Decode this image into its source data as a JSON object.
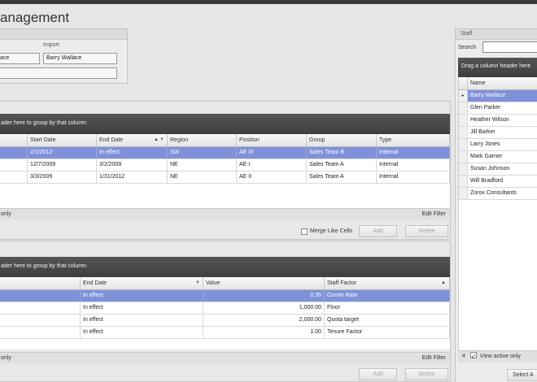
{
  "app": {
    "title": "anagement"
  },
  "import_panel": {
    "label": "Import",
    "left_value": "ace",
    "import_value": "Barry Wallace",
    "second_value": ""
  },
  "assignments": {
    "group_hint": "ader here to group by that column",
    "columns": [
      "Start Date",
      "End Date",
      "Region",
      "Position",
      "Group",
      "Type"
    ],
    "rows": [
      {
        "start": "2/1/2012",
        "end": "In effect",
        "region": "SW",
        "position": "AE III",
        "group": "Sales Team B",
        "type": "Internal",
        "selected": true
      },
      {
        "start": "12/7/2009",
        "end": "3/2/2009",
        "region": "NE",
        "position": "AE I",
        "group": "Sales Team A",
        "type": "Internal",
        "selected": false
      },
      {
        "start": "3/3/2009",
        "end": "1/31/2012",
        "region": "NE",
        "position": "AE II",
        "group": "Sales Team A",
        "type": "Internal",
        "selected": false
      }
    ],
    "footer_left": "only",
    "edit_filter": "Edit Filter",
    "merge_label": "Merge Like Cells",
    "add_label": "Add",
    "delete_label": "Delete"
  },
  "factors": {
    "group_hint": "ader here to group by that column",
    "columns": [
      "End Date",
      "Value",
      "Staff Factor"
    ],
    "rows": [
      {
        "end": "In effect",
        "value": "0.35",
        "factor": "Comm Rate",
        "selected": true
      },
      {
        "end": "In effect",
        "value": "1,000.00",
        "factor": "Floor",
        "selected": false
      },
      {
        "end": "In effect",
        "value": "2,000.00",
        "factor": "Quota target",
        "selected": false
      },
      {
        "end": "In effect",
        "value": "1.00",
        "factor": "Tenure Factor",
        "selected": false
      }
    ],
    "footer_left": "only",
    "edit_filter": "Edit Filter",
    "add_label": "Add",
    "delete_label": "Delete"
  },
  "staff": {
    "title": "Staff",
    "search_label": "Search",
    "search_value": "",
    "drag_hint": "Drag a column header here",
    "column": "Name",
    "names": [
      "Barry Wallace",
      "Glen Parker",
      "Heather Wilson",
      "Jill Barker",
      "Larry Jones",
      "Mark Garner",
      "Susan Johnson",
      "Will Bradford",
      "Zorox Consultants"
    ],
    "view_active": "View active only",
    "select_button": "Select A"
  },
  "colors": {
    "selection": "#7f92d9",
    "group_bar": "#444444"
  }
}
